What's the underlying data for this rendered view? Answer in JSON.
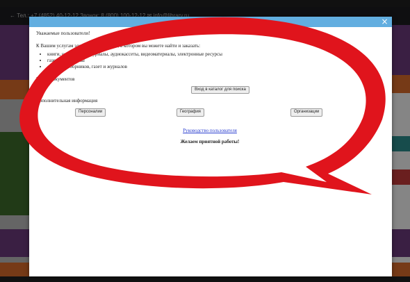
{
  "background": {
    "topbar_text": "← Тел.: +7 (4852) 40-12-12   Звонок: 8 (800) 100-12-12   ✉ info@library.ru"
  },
  "modal": {
    "close_label": "×",
    "greeting": "Уважаемые пользователи!",
    "intro": "К Вашим услугам электронный каталог, в котором вы можете найти и заказать:",
    "resources": [
      "книги, ноты, карты, журналы, аудиокассеты, видеоматериалы, электронные ресурсы",
      "газеты и журналы",
      "статьи из сборников, газет и журналов"
    ],
    "search_label": "Поиск документов",
    "catalog_button": "Вход в каталог для поиска",
    "extra_title": "Дополнительная информация",
    "buttons": {
      "persons": "Персоналии",
      "geography": "География",
      "organizations": "Организации"
    },
    "guide_link": "Руководство пользователя",
    "wish": "Желаем приятной работы!"
  },
  "colors": {
    "modal_bar": "#62aee0",
    "overlay_red": "#e0141c",
    "link": "#2a3ecf"
  },
  "icons": {
    "close": "close-icon"
  }
}
